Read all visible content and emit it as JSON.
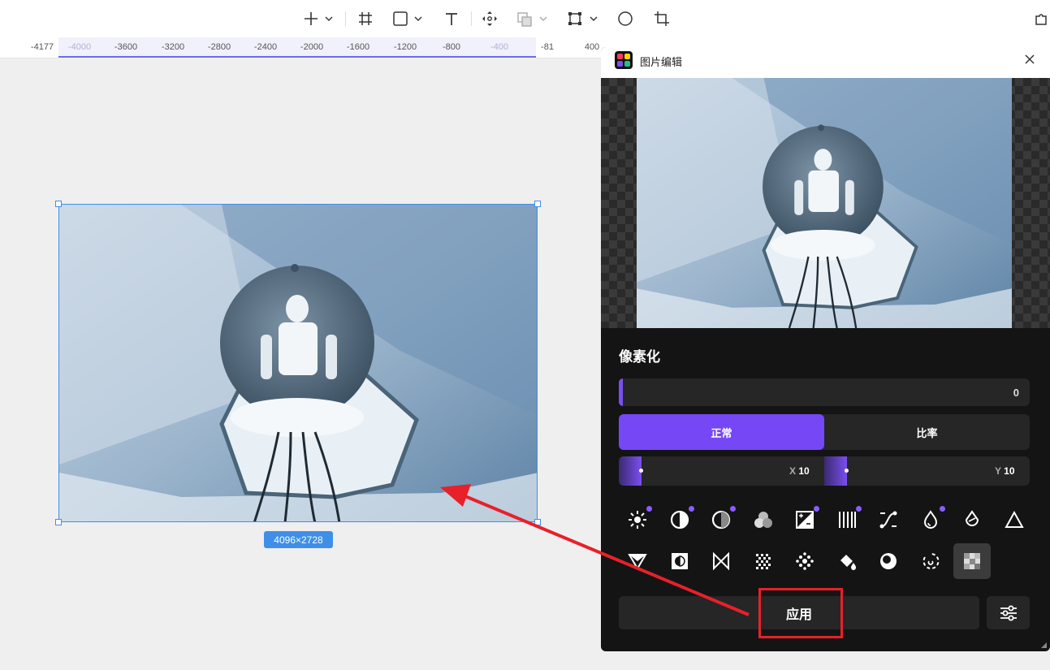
{
  "toolbar": {
    "icons": [
      "plus-icon",
      "frame-icon",
      "rectangle-icon",
      "text-icon",
      "move-icon",
      "boolean-icon",
      "component-icon",
      "circle-icon",
      "crop-icon",
      "plugin-icon"
    ]
  },
  "ruler": {
    "ticks": [
      "-4177",
      "-4000",
      "-3600",
      "-3200",
      "-2800",
      "-2400",
      "-2000",
      "-1600",
      "-1200",
      "-800",
      "-400",
      "-81",
      "400"
    ]
  },
  "canvas": {
    "image_dimensions": "4096×2728"
  },
  "panel": {
    "title": "图片编辑",
    "section_title": "像素化",
    "amount_value": "0",
    "mode_options": [
      "正常",
      "比率"
    ],
    "mode_selected": "正常",
    "x_label": "X",
    "x_value": "10",
    "y_label": "Y",
    "y_value": "10",
    "filters": [
      "brightness-icon",
      "contrast-icon",
      "saturation-icon",
      "color-mix-icon",
      "exposure-icon",
      "stripes-icon",
      "curves-icon",
      "drop-icon",
      "tint-icon",
      "triangle-icon",
      "triangle-down-icon",
      "invert-icon",
      "bowtie-icon",
      "noise-icon",
      "dots-icon",
      "fill-icon",
      "shade-icon",
      "rotate-icon",
      "pixelate-icon"
    ],
    "filters_with_badge": [
      0,
      1,
      2,
      4,
      5,
      7
    ],
    "filter_selected": 18,
    "apply_label": "应用"
  },
  "colors": {
    "accent": "#7547f5",
    "selection": "#3f8fe8",
    "annotation": "#e8202a"
  }
}
